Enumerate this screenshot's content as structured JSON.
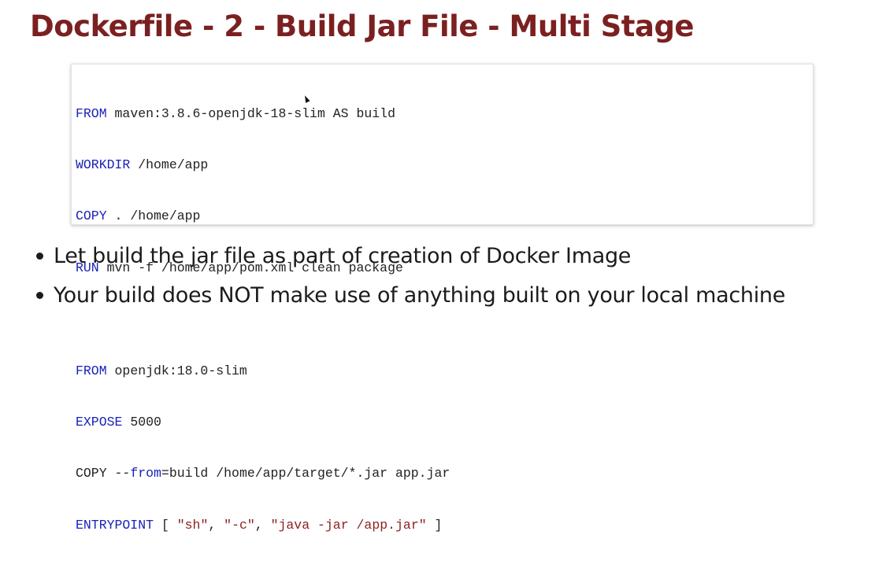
{
  "slide": {
    "title": "Dockerfile - 2 - Build Jar File - Multi Stage"
  },
  "code": {
    "lines": [
      {
        "keyword": "FROM",
        "text": " maven:3.8.6-openjdk-18-slim AS build"
      },
      {
        "keyword": "WORKDIR",
        "text": " /home/app"
      },
      {
        "keyword": "COPY",
        "text": " . /home/app"
      },
      {
        "keyword": "RUN",
        "text": " mvn -f /home/app/pom.xml clean package"
      },
      {
        "keyword": "",
        "text": ""
      },
      {
        "keyword": "FROM",
        "text": " openjdk:18.0-slim"
      },
      {
        "keyword": "EXPOSE",
        "text": " 5000"
      },
      {
        "line_pre": "COPY --",
        "line_kw": "from",
        "line_post": "=build /home/app/target/*.jar app.jar"
      },
      {
        "keyword": "ENTRYPOINT",
        "text": " [ ",
        "s1": "\"sh\"",
        "c1": ", ",
        "s2": "\"-c\"",
        "c2": ", ",
        "s3": "\"java -jar /app.jar\"",
        "end": " ]"
      }
    ]
  },
  "bullets": [
    "Let build the jar file as part of creation of Docker Image",
    "Your build does NOT make use of anything built on your local machine"
  ],
  "colors": {
    "title": "#7b2020",
    "keyword": "#1a22b8",
    "string": "#8a1f1f",
    "text": "#1b1b1b"
  },
  "icons": {
    "cursor": "mouse-cursor-icon",
    "bullet": "bullet-dot-icon"
  }
}
